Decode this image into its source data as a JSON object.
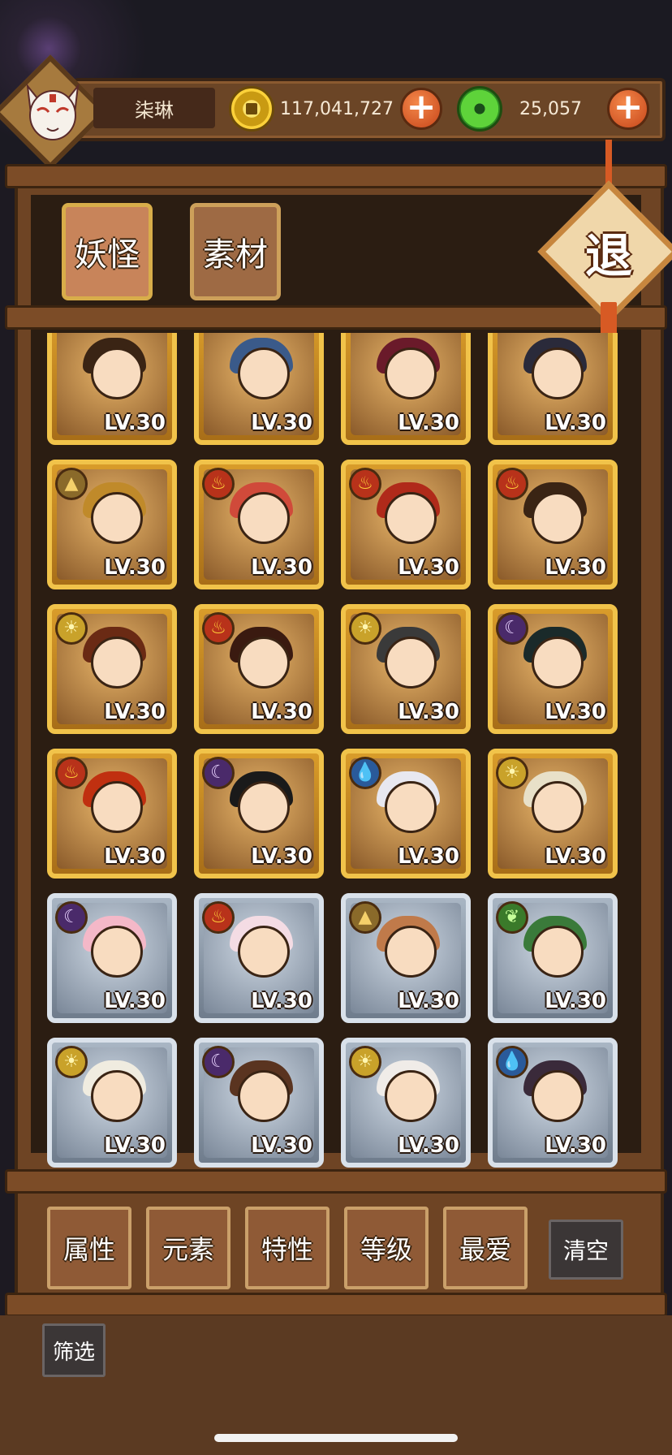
{
  "header": {
    "player_name": "柒琳",
    "coins": "117,041,727",
    "gems": "25,057",
    "coin_icon": "coin-icon",
    "gem_icon": "jade-icon",
    "add_icon": "plus-icon"
  },
  "tabs": [
    {
      "label": "妖怪",
      "active": true
    },
    {
      "label": "素材",
      "active": false
    }
  ],
  "exit_label": "退",
  "cards": [
    {
      "level": "LV.30",
      "frame": "gold",
      "element": null,
      "hair": "#3a2414"
    },
    {
      "level": "LV.30",
      "frame": "gold",
      "element": null,
      "hair": "#3a5a8a"
    },
    {
      "level": "LV.30",
      "frame": "gold",
      "element": null,
      "hair": "#6a1a2a"
    },
    {
      "level": "LV.30",
      "frame": "gold",
      "element": null,
      "hair": "#2a2a3a"
    },
    {
      "level": "LV.30",
      "frame": "gold",
      "element": "earth",
      "hair": "#c08a2a"
    },
    {
      "level": "LV.30",
      "frame": "gold",
      "element": "fire",
      "hair": "#d04a3a"
    },
    {
      "level": "LV.30",
      "frame": "gold",
      "element": "fire",
      "hair": "#b02a1a"
    },
    {
      "level": "LV.30",
      "frame": "gold",
      "element": "fire",
      "hair": "#3a2414"
    },
    {
      "level": "LV.30",
      "frame": "gold",
      "element": "sun",
      "hair": "#6a2a14"
    },
    {
      "level": "LV.30",
      "frame": "gold",
      "element": "fire",
      "hair": "#3a1a10"
    },
    {
      "level": "LV.30",
      "frame": "gold",
      "element": "sun",
      "hair": "#3a3a3a"
    },
    {
      "level": "LV.30",
      "frame": "gold",
      "element": "dark",
      "hair": "#1a2a2a"
    },
    {
      "level": "LV.30",
      "frame": "gold",
      "element": "fire",
      "hair": "#c03010"
    },
    {
      "level": "LV.30",
      "frame": "gold",
      "element": "dark",
      "hair": "#1a1a1a"
    },
    {
      "level": "LV.30",
      "frame": "gold",
      "element": "water",
      "hair": "#e8e8f0"
    },
    {
      "level": "LV.30",
      "frame": "gold",
      "element": "sun",
      "hair": "#e8e0c8"
    },
    {
      "level": "LV.30",
      "frame": "silver",
      "element": "dark",
      "hair": "#f4b8c8"
    },
    {
      "level": "LV.30",
      "frame": "silver",
      "element": "fire",
      "hair": "#f4dce4"
    },
    {
      "level": "LV.30",
      "frame": "silver",
      "element": "earth",
      "hair": "#c07a4a"
    },
    {
      "level": "LV.30",
      "frame": "silver",
      "element": "wood",
      "hair": "#3a7a3a"
    },
    {
      "level": "LV.30",
      "frame": "silver",
      "element": "sun",
      "hair": "#f0ece0"
    },
    {
      "level": "LV.30",
      "frame": "silver",
      "element": "dark",
      "hair": "#5a3420"
    },
    {
      "level": "LV.30",
      "frame": "silver",
      "element": "sun",
      "hair": "#f0ece8"
    },
    {
      "level": "LV.30",
      "frame": "silver",
      "element": "water",
      "hair": "#3a2a3a"
    }
  ],
  "element_glyphs": {
    "fire": "♨",
    "earth": "▲",
    "sun": "☀",
    "dark": "☾",
    "water": "💧",
    "wood": "❦"
  },
  "filters": [
    "属性",
    "元素",
    "特性",
    "等级",
    "最爱"
  ],
  "clear_label": "清空",
  "screen_label": "筛选"
}
